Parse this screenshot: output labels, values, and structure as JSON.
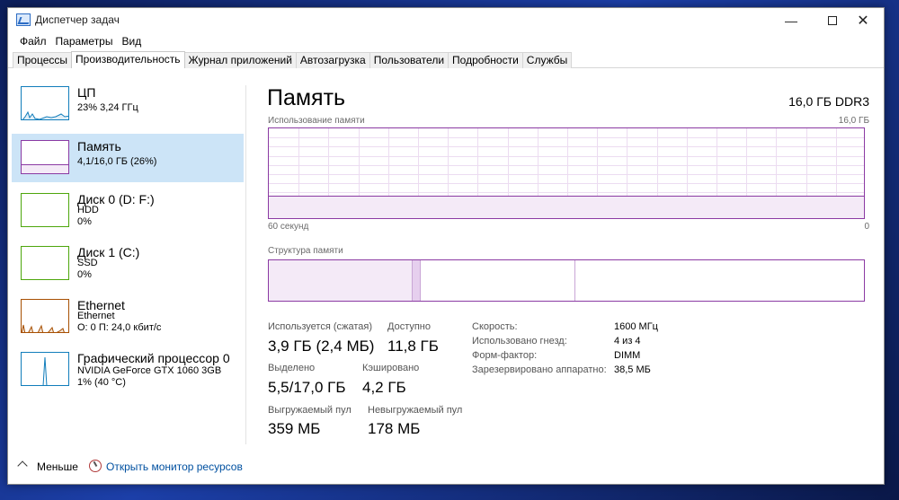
{
  "window": {
    "title": "Диспетчер задач",
    "controls": {
      "minimize": "—",
      "close": "✕"
    }
  },
  "menu": [
    "Файл",
    "Параметры",
    "Вид"
  ],
  "tabs": [
    {
      "label": "Процессы",
      "active": false
    },
    {
      "label": "Производительность",
      "active": true
    },
    {
      "label": "Журнал приложений",
      "active": false
    },
    {
      "label": "Автозагрузка",
      "active": false
    },
    {
      "label": "Пользователи",
      "active": false
    },
    {
      "label": "Подробности",
      "active": false
    },
    {
      "label": "Службы",
      "active": false
    }
  ],
  "sidebar": [
    {
      "title": "ЦП",
      "lines": [
        "23% 3,24 ГГц"
      ],
      "color": "#117dbb",
      "selected": false
    },
    {
      "title": "Память",
      "lines": [
        "4,1/16,0 ГБ (26%)"
      ],
      "color": "#8b3aa3",
      "selected": true
    },
    {
      "title": "Диск 0 (D: F:)",
      "lines": [
        "HDD",
        "0%"
      ],
      "color": "#4da60c",
      "selected": false
    },
    {
      "title": "Диск 1 (C:)",
      "lines": [
        "SSD",
        "0%"
      ],
      "color": "#4da60c",
      "selected": false
    },
    {
      "title": "Ethernet",
      "lines": [
        "Ethernet",
        "О: 0 П: 24,0 кбит/с"
      ],
      "color": "#a74f01",
      "selected": false
    },
    {
      "title": "Графический процессор 0",
      "lines": [
        "NVIDIA GeForce GTX 1060 3GB",
        "1% (40 °C)"
      ],
      "color": "#117dbb",
      "selected": false
    }
  ],
  "main": {
    "title": "Память",
    "spec": "16,0 ГБ DDR3",
    "usage_label": "Использование памяти",
    "usage_max": "16,0 ГБ",
    "usage_fraction": 0.26,
    "time_left": "60 секунд",
    "time_right": "0",
    "structure_label": "Структура памяти",
    "structure": {
      "in_use": 0.24,
      "modified": 0.013,
      "standby": 0.26,
      "free": 0.487
    },
    "stats": [
      {
        "label": "Используется (сжатая)",
        "value": "3,9 ГБ (2,4 МБ)"
      },
      {
        "label": "Доступно",
        "value": "11,8 ГБ"
      },
      {
        "label": "Выделено",
        "value": "5,5/17,0 ГБ"
      },
      {
        "label": "Кэшировано",
        "value": "4,2 ГБ"
      },
      {
        "label": "Выгружаемый пул",
        "value": "359 МБ"
      },
      {
        "label": "Невыгружаемый пул",
        "value": "178 МБ"
      }
    ],
    "details": [
      {
        "label": "Скорость:",
        "value": "1600 МГц"
      },
      {
        "label": "Использовано гнезд:",
        "value": "4 из 4"
      },
      {
        "label": "Форм-фактор:",
        "value": "DIMM"
      },
      {
        "label": "Зарезервировано аппаратно:",
        "value": "38,5 МБ"
      }
    ]
  },
  "footer": {
    "less": "Меньше",
    "resource_monitor": "Открыть монитор ресурсов"
  },
  "colors": {
    "memory": "#8b3aa3",
    "memory_fill": "#f4eaf7",
    "cpu": "#117dbb",
    "disk": "#4da60c",
    "ethernet": "#a74f01",
    "selection": "#cce4f7"
  }
}
